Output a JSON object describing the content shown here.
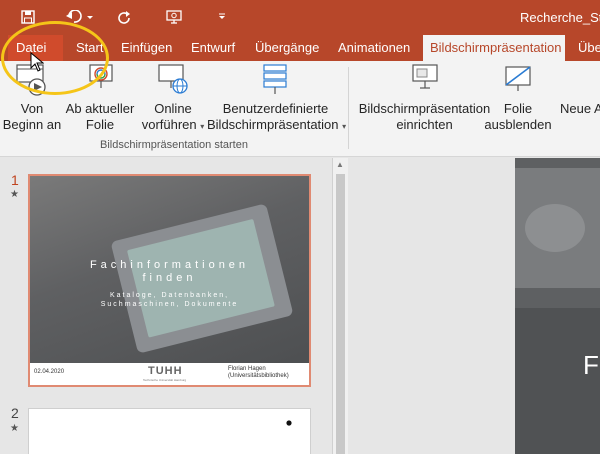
{
  "title_bar": {
    "doc_title": "Recherche_Stra",
    "qat_icons": [
      "save-icon",
      "undo-icon",
      "redo-icon",
      "present-from-beginning-icon",
      "customize-qat-icon"
    ]
  },
  "tabs": [
    "Datei",
    "Start",
    "Einfügen",
    "Entwurf",
    "Übergänge",
    "Animationen",
    "Bildschirmpräsentation",
    "Übe"
  ],
  "active_tab": "Bildschirmpräsentation",
  "ribbon": {
    "group_label": "Bildschirmpräsentation starten",
    "buttons": [
      {
        "line1": "Von",
        "line2": "Beginn an",
        "icon": "play-from-start-icon"
      },
      {
        "line1": "Ab aktueller",
        "line2": "Folie",
        "icon": "play-from-current-icon"
      },
      {
        "line1": "Online",
        "line2": "vorführen",
        "icon": "present-online-icon"
      },
      {
        "line1": "Benutzerdefinierte",
        "line2": "Bildschirmpräsentation",
        "icon": "custom-show-icon"
      },
      {
        "line1": "Bildschirmpräsentation",
        "line2": "einrichten",
        "icon": "setup-show-icon"
      },
      {
        "line1": "Folie",
        "line2": "ausblenden",
        "icon": "hide-slide-icon"
      },
      {
        "line1": "Neue A",
        "line2": "",
        "icon": ""
      }
    ]
  },
  "slides": [
    {
      "number": "1",
      "title": "Fachinformationen finden",
      "title_line1": "Fachinformationen",
      "title_line2": "finden",
      "subtitle_line1": "Kataloge, Datenbanken,",
      "subtitle_line2": "Suchmaschinen, Dokumente",
      "date": "02.04.2020",
      "logo": "TUHH",
      "logo_sub": "Technische Universität Hamburg",
      "author_line1": "Florian Hagen",
      "author_line2": "(Universitätsbibliothek)"
    },
    {
      "number": "2"
    }
  ],
  "editor": {
    "visible_letter": "F"
  },
  "colors": {
    "accent": "#b7472a",
    "file_tab": "#d04b2c",
    "highlight": "#f5c518"
  }
}
